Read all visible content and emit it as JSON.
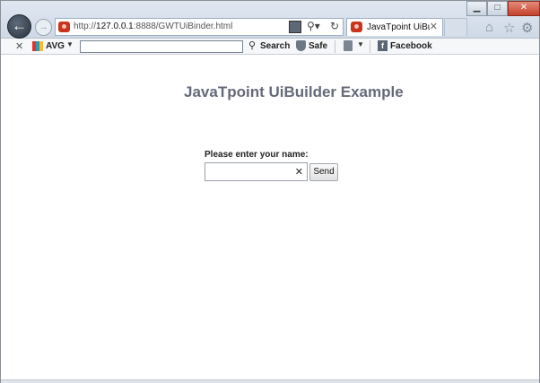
{
  "browser": {
    "url_prefix": "http://",
    "url_host": "127.0.0.1",
    "url_rest": ":8888/GWTUiBinder.html",
    "tab_label": "JavaTpoint UiBui...",
    "back_glyph": "←",
    "forward_glyph": "→",
    "search_glyph": "⚲▾",
    "refresh_glyph": "↻",
    "tab_close_glyph": "✕",
    "minimize_glyph": "▁",
    "maximize_glyph": "□",
    "close_glyph": "✕",
    "home_glyph": "⌂",
    "favorites_glyph": "☆",
    "tools_glyph": "⚙"
  },
  "toolbar": {
    "close_glyph": "✕",
    "avg_label": "AVG",
    "dropdown_glyph": "▼",
    "search_glyph": "⚲",
    "search_label": "Search",
    "safe_label": "Safe",
    "facebook_glyph": "f",
    "facebook_label": "Facebook"
  },
  "page": {
    "title": "JavaTpoint UiBuilder Example",
    "name_label": "Please enter your name:",
    "name_value": "",
    "clear_glyph": "✕",
    "send_label": "Send"
  },
  "colors": {
    "title": "#666a78",
    "chrome_bg": "#dfe7f1",
    "close_button": "#c3412a"
  }
}
